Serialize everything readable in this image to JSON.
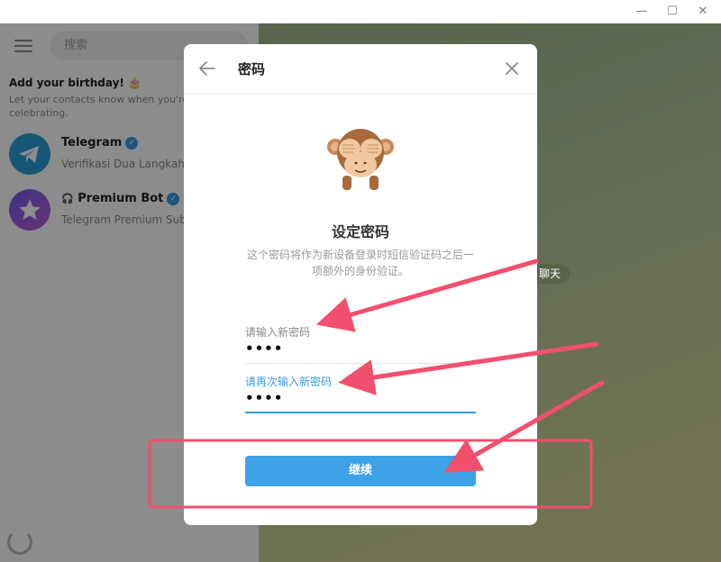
{
  "window": {
    "minimize": "—",
    "maximize": "☐",
    "close": "✕"
  },
  "sidebar": {
    "search_placeholder": "搜索",
    "birthday_title": "Add your birthday!",
    "birthday_cake": "🎂",
    "birthday_text": "Let your contacts know when you're celebrating.",
    "chats": [
      {
        "name": "Telegram",
        "preview": "Verifikasi Dua Langkah"
      },
      {
        "name": "Premium Bot",
        "prefix_icon": "🎧",
        "preview": "Telegram Premium Sub"
      }
    ]
  },
  "chat_pill": "聊天",
  "modal": {
    "title": "密码",
    "heading": "设定密码",
    "description": "这个密码将作为新设备登录时短信验证码之后一项额外的身份验证。",
    "field1_label": "请输入新密码",
    "field1_value": "••••",
    "field2_label": "请再次输入新密码",
    "field2_value": "••••",
    "continue_label": "继续"
  },
  "colors": {
    "accent": "#3ea2e6",
    "annotation": "#f0506e"
  }
}
